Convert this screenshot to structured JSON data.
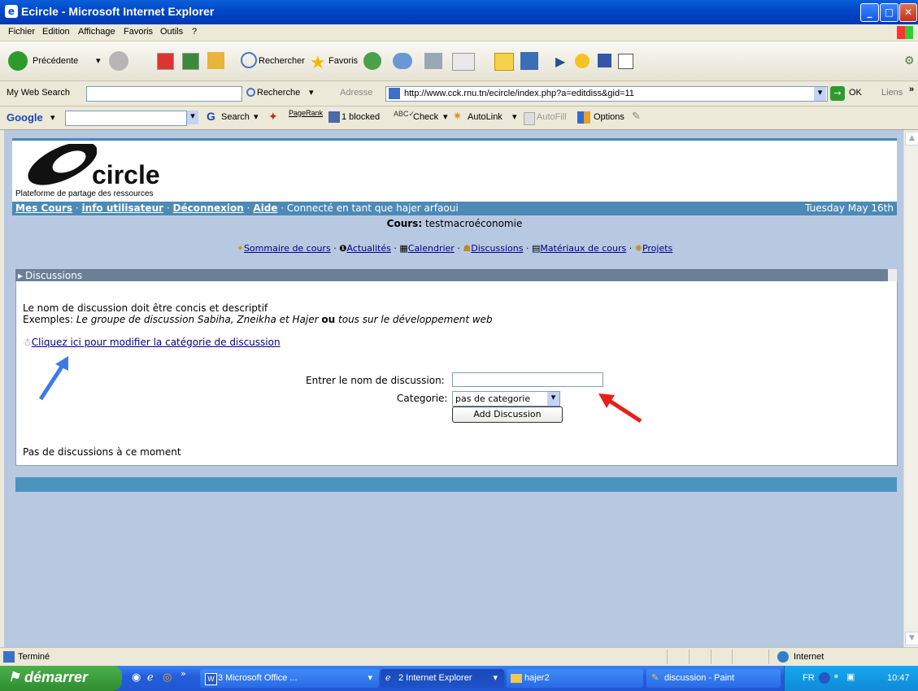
{
  "window": {
    "title": "Ecircle - Microsoft Internet Explorer"
  },
  "menu": [
    "Fichier",
    "Edition",
    "Affichage",
    "Favoris",
    "Outils",
    "?"
  ],
  "toolbar": {
    "back": "Précédente",
    "search": "Rechercher",
    "favorites": "Favoris"
  },
  "searchbar": {
    "label": "My Web Search",
    "button": "Recherche",
    "address_label": "Adresse",
    "url": "http://www.cck.rnu.tn/ecircle/index.php?a=editdiss&gid=11",
    "go": "OK",
    "links": "Liens"
  },
  "googlebar": {
    "logo": "Google",
    "search": "Search",
    "pagerank": "PageRank",
    "blocked": "1 blocked",
    "check": "Check",
    "autolink": "AutoLink",
    "autofill": "AutoFill",
    "options": "Options"
  },
  "site": {
    "logo_text": "circle",
    "logo_tagline": "Plateforme de partage des ressources",
    "nav": {
      "mes_cours": "Mes Cours",
      "info": "info utilisateur",
      "deconnexion": "Déconnexion",
      "aide": "Aide",
      "connected": "Connecté en tant que hajer arfaoui",
      "date": "Tuesday May 16th"
    },
    "course_label": "Cours:",
    "course_name": "testmacroéconomie",
    "course_nav": [
      "Sommaire de cours",
      "Actualités",
      "Calendrier",
      "Discussions",
      "Matériaux de cours",
      "Projets"
    ],
    "section_title": "Discussions",
    "intro1": "Le nom de discussion doit être concis et descriptif",
    "intro2_prefix": "Exemples: ",
    "intro2_ex1": "Le groupe de discussion Sabiha, Zneikha et Hajer",
    "intro2_ou": "ou",
    "intro2_ex2": "tous sur le développement web",
    "modify_link": "Cliquez ici pour modifier la catégorie de discussion",
    "name_label": "Entrer le nom de discussion:",
    "name_value": "",
    "category_label": "Categorie:",
    "category_selected": "pas de categorie",
    "add_button": "Add Discussion",
    "empty_msg": "Pas de discussions à ce moment"
  },
  "status": {
    "left": "Terminé",
    "zone": "Internet"
  },
  "taskbar": {
    "start": "démarrer",
    "tasks": [
      "3 Microsoft Office ...",
      "2 Internet Explorer",
      "hajer2",
      "discussion - Paint"
    ],
    "lang": "FR",
    "time": "10:47"
  },
  "colors": {
    "nav_blue": "#4d8ab5",
    "page_bg": "#b7c8e1",
    "arrow_blue": "#3b7be8",
    "arrow_red": "#e8201a"
  }
}
